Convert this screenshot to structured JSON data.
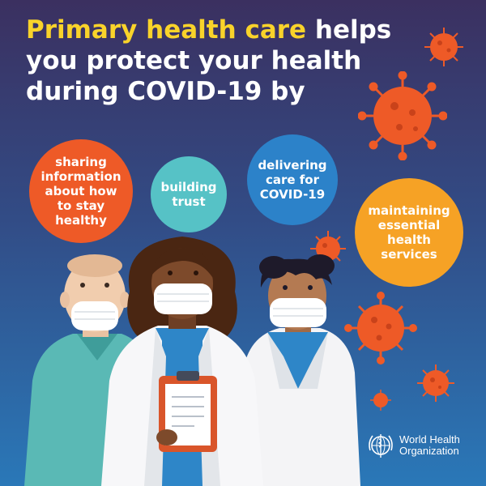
{
  "headline": {
    "highlight": "Primary health care",
    "rest": " helps you protect your health during COVID-19 by"
  },
  "bubbles": [
    {
      "label": "sharing information about how to stay healthy",
      "color": "#ee5a27"
    },
    {
      "label": "building trust",
      "color": "#56c2c6"
    },
    {
      "label": "delivering care for COVID-19",
      "color": "#2c82c9"
    },
    {
      "label": "maintaining essential health services",
      "color": "#f6a225"
    }
  ],
  "logo": {
    "line1": "World Health",
    "line2": "Organization",
    "emblem_icon": "who-emblem-icon"
  },
  "colors": {
    "headline_highlight": "#f9d32a",
    "virus": "#ee5a27"
  }
}
